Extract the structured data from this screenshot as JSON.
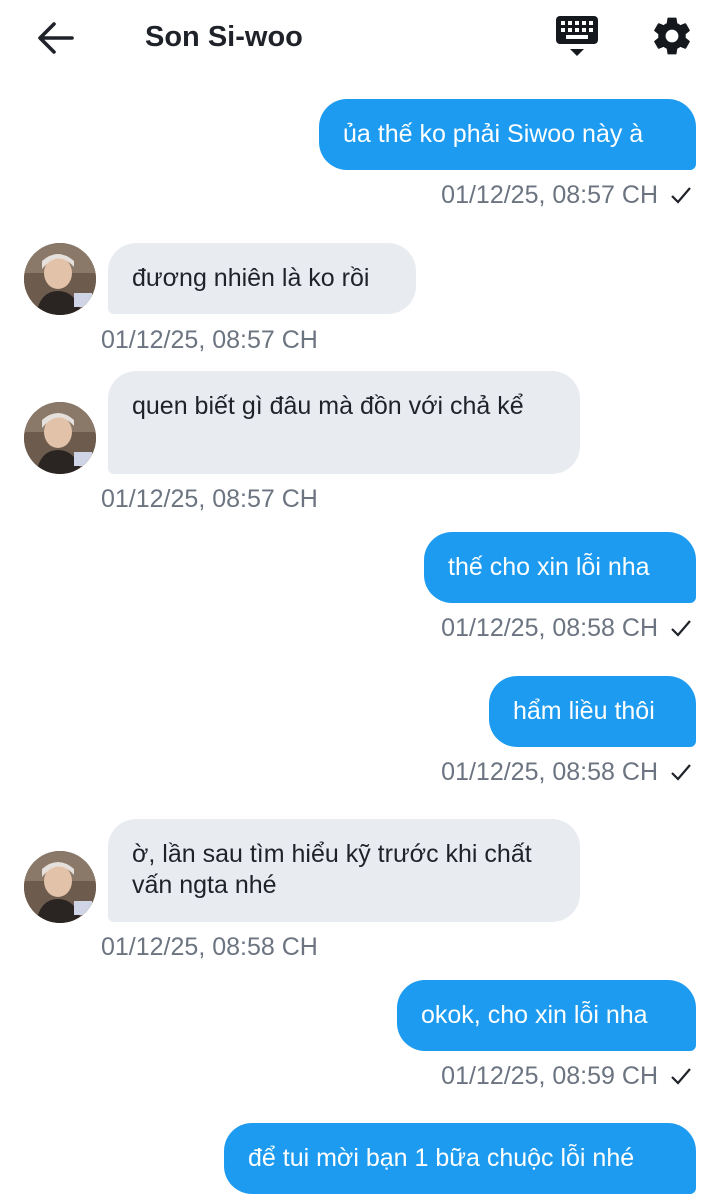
{
  "header": {
    "title": "Son Si-woo",
    "back_icon": "arrow-left-icon",
    "keyboard_icon": "keyboard-icon",
    "settings_icon": "gear-icon"
  },
  "colors": {
    "outgoing_bubble": "#1d9bf0",
    "incoming_bubble": "#e8ebef",
    "timestamp": "#6b7480"
  },
  "messages": [
    {
      "direction": "out",
      "text": "ủa thế ko phải Siwoo này à",
      "time": "01/12/25, 08:57 CH",
      "status_icon": "check-icon"
    },
    {
      "direction": "in",
      "text": "đương nhiên là ko rồi",
      "time": "01/12/25, 08:57 CH"
    },
    {
      "direction": "in",
      "text": "quen biết gì đâu mà đồn với chả kể",
      "time": "01/12/25, 08:57 CH"
    },
    {
      "direction": "out",
      "text": "thế cho xin lỗi nha",
      "time": "01/12/25, 08:58 CH",
      "status_icon": "check-icon"
    },
    {
      "direction": "out",
      "text": "hẩm liều thôi",
      "time": "01/12/25, 08:58 CH",
      "status_icon": "check-icon"
    },
    {
      "direction": "in",
      "text": "ờ, lần sau tìm hiểu kỹ trước khi chất vấn ngta nhé",
      "time": "01/12/25, 08:58 CH"
    },
    {
      "direction": "out",
      "text": "okok, cho xin lỗi nha",
      "time": "01/12/25, 08:59 CH",
      "status_icon": "check-icon"
    },
    {
      "direction": "out",
      "text": "để tui mời bạn 1 bữa chuộc lỗi nhé",
      "time": "",
      "status_icon": ""
    }
  ]
}
